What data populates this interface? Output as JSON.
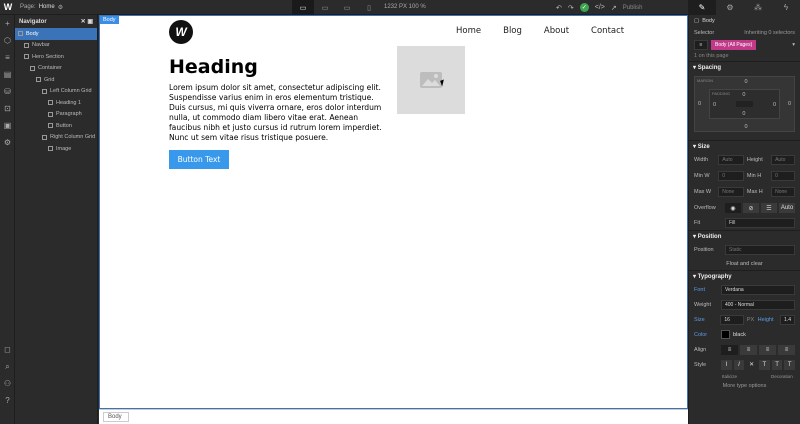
{
  "topbar": {
    "page_label": "Page:",
    "page_name": "Home",
    "canvas_size": "1232 PX  100 %",
    "publish": "Publish"
  },
  "navigator": {
    "title": "Navigator",
    "items": [
      {
        "label": "Body",
        "depth": 0,
        "selected": true
      },
      {
        "label": "Navbar",
        "depth": 1,
        "selected": false
      },
      {
        "label": "Hero Section",
        "depth": 1,
        "selected": false
      },
      {
        "label": "Container",
        "depth": 2,
        "selected": false
      },
      {
        "label": "Grid",
        "depth": 3,
        "selected": false
      },
      {
        "label": "Left Column Grid",
        "depth": 4,
        "selected": false
      },
      {
        "label": "Heading 1",
        "depth": 5,
        "selected": false
      },
      {
        "label": "Paragraph",
        "depth": 5,
        "selected": false
      },
      {
        "label": "Button",
        "depth": 5,
        "selected": false
      },
      {
        "label": "Right Column Grid",
        "depth": 4,
        "selected": false
      },
      {
        "label": "Image",
        "depth": 5,
        "selected": false
      }
    ]
  },
  "canvas": {
    "body_tag": "Body",
    "logo_letter": "W",
    "nav_links": [
      "Home",
      "Blog",
      "About",
      "Contact"
    ],
    "heading": "Heading",
    "paragraph": "Lorem ipsum dolor sit amet, consectetur adipiscing elit. Suspendisse varius enim in eros elementum tristique. Duis cursus, mi quis viverra ornare, eros dolor interdum nulla, ut commodo diam libero vitae erat. Aenean faucibus nibh et justo cursus id rutrum lorem imperdiet. Nunc ut sem vitae risus tristique posuere.",
    "button": "Button Text"
  },
  "breadcrumb": {
    "item": "Body"
  },
  "panel": {
    "element_name": "Body",
    "selector_label": "Selector",
    "inheriting": "Inheriting 0 selectors",
    "selector_chip": "Body (All Pages)",
    "on_page": "1 on this page",
    "spacing_title": "Spacing",
    "margin_label": "MARGIN",
    "padding_label": "PADDING",
    "spacing_values": [
      "0",
      "0",
      "0",
      "0",
      "0",
      "0",
      "0",
      "0"
    ],
    "size_title": "Size",
    "width_label": "Width",
    "width_val": "Auto",
    "height_label": "Height",
    "height_val": "Auto",
    "minw_label": "Min W",
    "minw_val": "0",
    "minh_label": "Min H",
    "minh_val": "0",
    "maxw_label": "Max W",
    "maxw_val": "None",
    "maxh_label": "Max H",
    "maxh_val": "None",
    "overflow_label": "Overflow",
    "overflow_auto": "Auto",
    "fit_label": "Fit",
    "fit_val": "Fill",
    "position_title": "Position",
    "position_label": "Position",
    "position_val": "Static",
    "float_clear": "Float and clear",
    "typography_title": "Typography",
    "font_label": "Font",
    "font_val": "Verdana",
    "weight_label": "Weight",
    "weight_val": "400 - Normal",
    "size_label": "Size",
    "size_val": "16",
    "size_unit": "PX",
    "height2_label": "Height",
    "height2_val": "1.4",
    "color_label": "Color",
    "color_val": "black",
    "align_label": "Align",
    "style_label": "Style",
    "italicize": "Italicize",
    "decoration": "Decoration",
    "more_type": "More type options"
  },
  "colors": {
    "accent": "#3898ec",
    "selection": "#3b73b8",
    "chip": "#c03a89",
    "publish_ok": "#3ea452"
  }
}
